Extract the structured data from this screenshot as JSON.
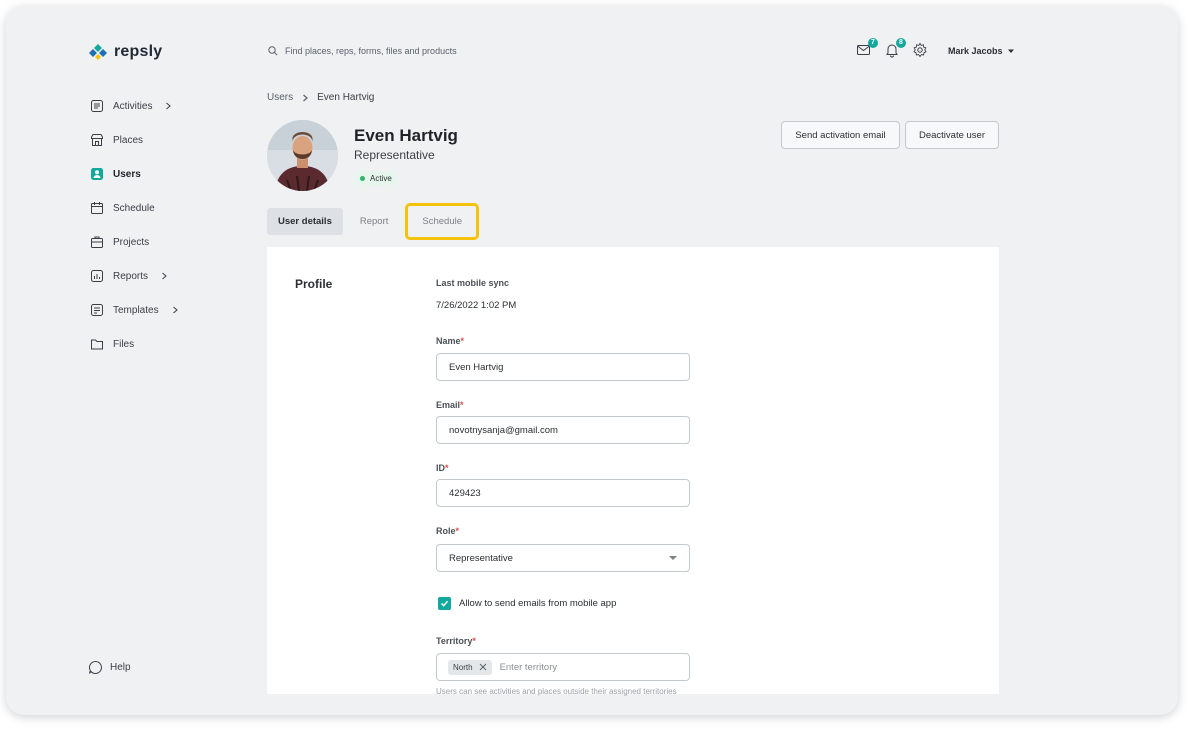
{
  "app": {
    "logo_text": "repsly"
  },
  "header": {
    "search_placeholder": "Find places, reps, forms, files and products",
    "mail_badge": "7",
    "notification_badge": "8",
    "user_name": "Mark Jacobs"
  },
  "sidebar": {
    "items": [
      {
        "label": "Activities",
        "icon": "list-icon",
        "has_chevron": true
      },
      {
        "label": "Places",
        "icon": "store-icon",
        "has_chevron": false
      },
      {
        "label": "Users",
        "icon": "user-icon",
        "has_chevron": false,
        "active": true
      },
      {
        "label": "Schedule",
        "icon": "calendar-icon",
        "has_chevron": false
      },
      {
        "label": "Projects",
        "icon": "briefcase-icon",
        "has_chevron": false
      },
      {
        "label": "Reports",
        "icon": "chart-icon",
        "has_chevron": true
      },
      {
        "label": "Templates",
        "icon": "template-icon",
        "has_chevron": true
      },
      {
        "label": "Files",
        "icon": "folder-icon",
        "has_chevron": false
      }
    ],
    "help_label": "Help"
  },
  "breadcrumb": {
    "root": "Users",
    "current": "Even Hartvig"
  },
  "user": {
    "name": "Even Hartvig",
    "role": "Representative",
    "status": "Active"
  },
  "actions": {
    "send_activation": "Send activation email",
    "deactivate": "Deactivate user"
  },
  "tabs": [
    {
      "label": "User details",
      "active": true
    },
    {
      "label": "Report",
      "active": false
    },
    {
      "label": "Schedule",
      "active": false,
      "highlighted": true
    }
  ],
  "profile": {
    "section_title": "Profile",
    "last_sync_label": "Last mobile sync",
    "last_sync_value": "7/26/2022 1:02 PM",
    "name_label": "Name",
    "name_value": "Even Hartvig",
    "email_label": "Email",
    "email_value": "novotnysanja@gmail.com",
    "id_label": "ID",
    "id_value": "429423",
    "role_label": "Role",
    "role_value": "Representative",
    "allow_emails_label": "Allow to send emails from mobile app",
    "allow_emails_checked": true,
    "territory_label": "Territory",
    "territory_tag": "North",
    "territory_placeholder": "Enter territory",
    "territory_hint": "Users can see activities and places outside their assigned territories"
  },
  "colors": {
    "accent": "#12a89d",
    "highlight": "#f5c20c",
    "required": "#d9534f"
  }
}
